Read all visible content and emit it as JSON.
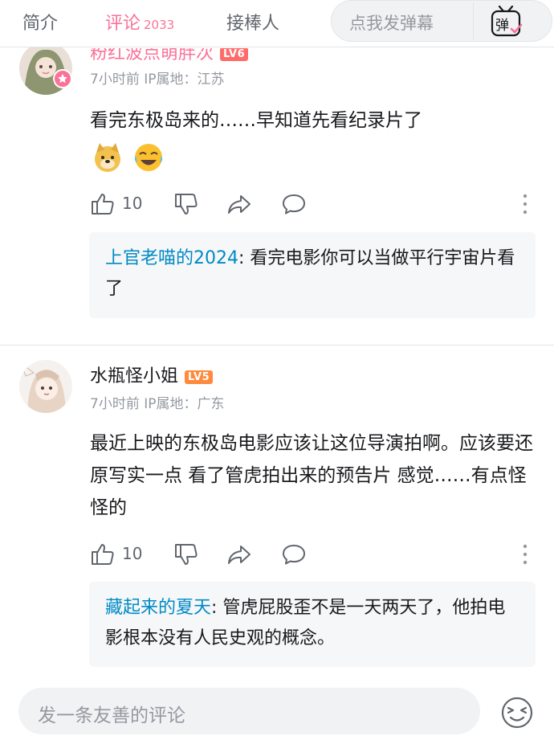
{
  "tabs": {
    "intro": "简介",
    "comments_label": "评论",
    "comments_count": "2033",
    "relay": "接棒人"
  },
  "danmaku": {
    "placeholder": "点我发弹幕",
    "toggle_glyph": "弹"
  },
  "comments": [
    {
      "username": "粉红波点萌胖次",
      "level": "LV6",
      "time": "7小时前",
      "ip": "IP属地：江苏",
      "text": "看完东极岛来的……早知道先看纪录片了",
      "emojis": [
        "doge-emoji",
        "laugh-cry-emoji"
      ],
      "likes": "10",
      "reply": {
        "user": "上官老喵的2024",
        "text": ": 看完电影你可以当做平行宇宙片看了"
      }
    },
    {
      "username": "水瓶怪小姐",
      "level": "LV5",
      "time": "7小时前",
      "ip": "IP属地：广东",
      "text": "最近上映的东极岛电影应该让这位导演拍啊。应该要还原写实一点 看了管虎拍出来的预告片 感觉……有点怪怪的",
      "likes": "10",
      "reply": {
        "user": "藏起来的夏天",
        "text": ": 管虎屁股歪不是一天两天了，他拍电影根本没有人民史观的概念。"
      }
    }
  ],
  "input": {
    "placeholder": "发一条友善的评论"
  },
  "colors": {
    "accent": "#fb7299",
    "reply_user": "#008ac5",
    "level_badge": "#ff8a3d"
  }
}
